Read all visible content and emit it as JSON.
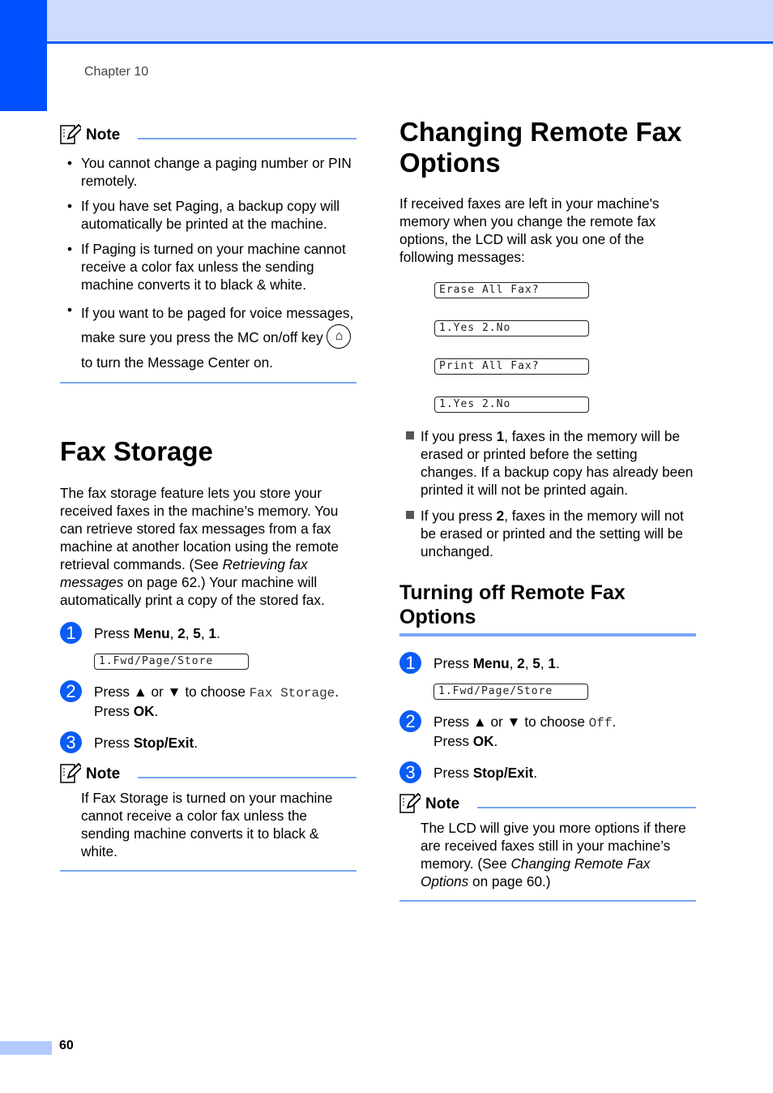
{
  "header": {
    "chapter": "Chapter 10"
  },
  "colors": {
    "accent": "#0050ff",
    "band": "#ccdcfa",
    "rule": "#7aa6f2"
  },
  "left": {
    "note1": {
      "label": "Note",
      "bullets": [
        "You cannot change a paging number or PIN remotely.",
        "If you have set Paging, a backup copy will automatically be printed at the machine.",
        "If Paging is turned on your machine cannot receive a color fax unless the sending machine converts it to black & white."
      ],
      "last_bullet_a": "If you want to be paged for voice messages, make sure you press the MC on/off key",
      "last_bullet_b": "to turn the Message Center on."
    },
    "fax_storage": {
      "title": "Fax Storage",
      "intro_a": "The fax storage feature lets you store your received faxes in the machine’s memory. You can retrieve stored fax messages from a fax machine at another location using the remote retrieval commands. (See ",
      "intro_link": "Retrieving fax messages",
      "intro_b": " on page 62.) Your machine will automatically print a copy of the stored fax.",
      "steps": [
        {
          "n": "1",
          "pre": "Press ",
          "bold": "Menu",
          "post": ", ",
          "b2": "2",
          "p2": ", ",
          "b3": "5",
          "p3": ", ",
          "b4": "1",
          "p4": ".",
          "lcd": "1.Fwd/Page/Store"
        },
        {
          "n": "2",
          "pre": "Press ▲ or ▼ to choose ",
          "mono": "Fax Storage",
          "post": ".",
          "line2_pre": "Press ",
          "line2_bold": "OK",
          "line2_post": "."
        },
        {
          "n": "3",
          "pre": "Press ",
          "bold": "Stop/Exit",
          "post": "."
        }
      ]
    },
    "note2": {
      "label": "Note",
      "text": "If Fax Storage is turned on your machine cannot receive a color fax unless the sending machine converts it to black & white."
    }
  },
  "right": {
    "changing": {
      "title": "Changing Remote Fax Options",
      "intro": "If received faxes are left in your machine's memory when you change the remote fax options, the LCD will ask you one of the following messages:",
      "lcds": [
        "Erase All Fax?",
        "1.Yes 2.No",
        "Print All Fax?",
        "1.Yes 2.No"
      ],
      "bullets": [
        {
          "pre": "If you press ",
          "bold": "1",
          "post": ", faxes in the memory will be erased or printed before the setting changes. If a backup copy has already been printed it will not be printed again."
        },
        {
          "pre": "If you press ",
          "bold": "2",
          "post": ", faxes in the memory will not be erased or printed and the setting will be unchanged."
        }
      ]
    },
    "turning_off": {
      "title": "Turning off Remote Fax Options",
      "steps": [
        {
          "n": "1",
          "pre": "Press ",
          "bold": "Menu",
          "post": ", ",
          "b2": "2",
          "p2": ", ",
          "b3": "5",
          "p3": ", ",
          "b4": "1",
          "p4": ".",
          "lcd": "1.Fwd/Page/Store"
        },
        {
          "n": "2",
          "pre": "Press ▲ or ▼ to choose ",
          "mono": "Off",
          "post": ".",
          "line2_pre": "Press ",
          "line2_bold": "OK",
          "line2_post": "."
        },
        {
          "n": "3",
          "pre": "Press ",
          "bold": "Stop/Exit",
          "post": "."
        }
      ]
    },
    "note3": {
      "label": "Note",
      "text_a": "The LCD will give you more options if there are received faxes still in your machine’s memory. (See ",
      "link": "Changing Remote Fax Options",
      "text_b": " on page 60.)"
    }
  },
  "footer": {
    "page_number": "60"
  }
}
